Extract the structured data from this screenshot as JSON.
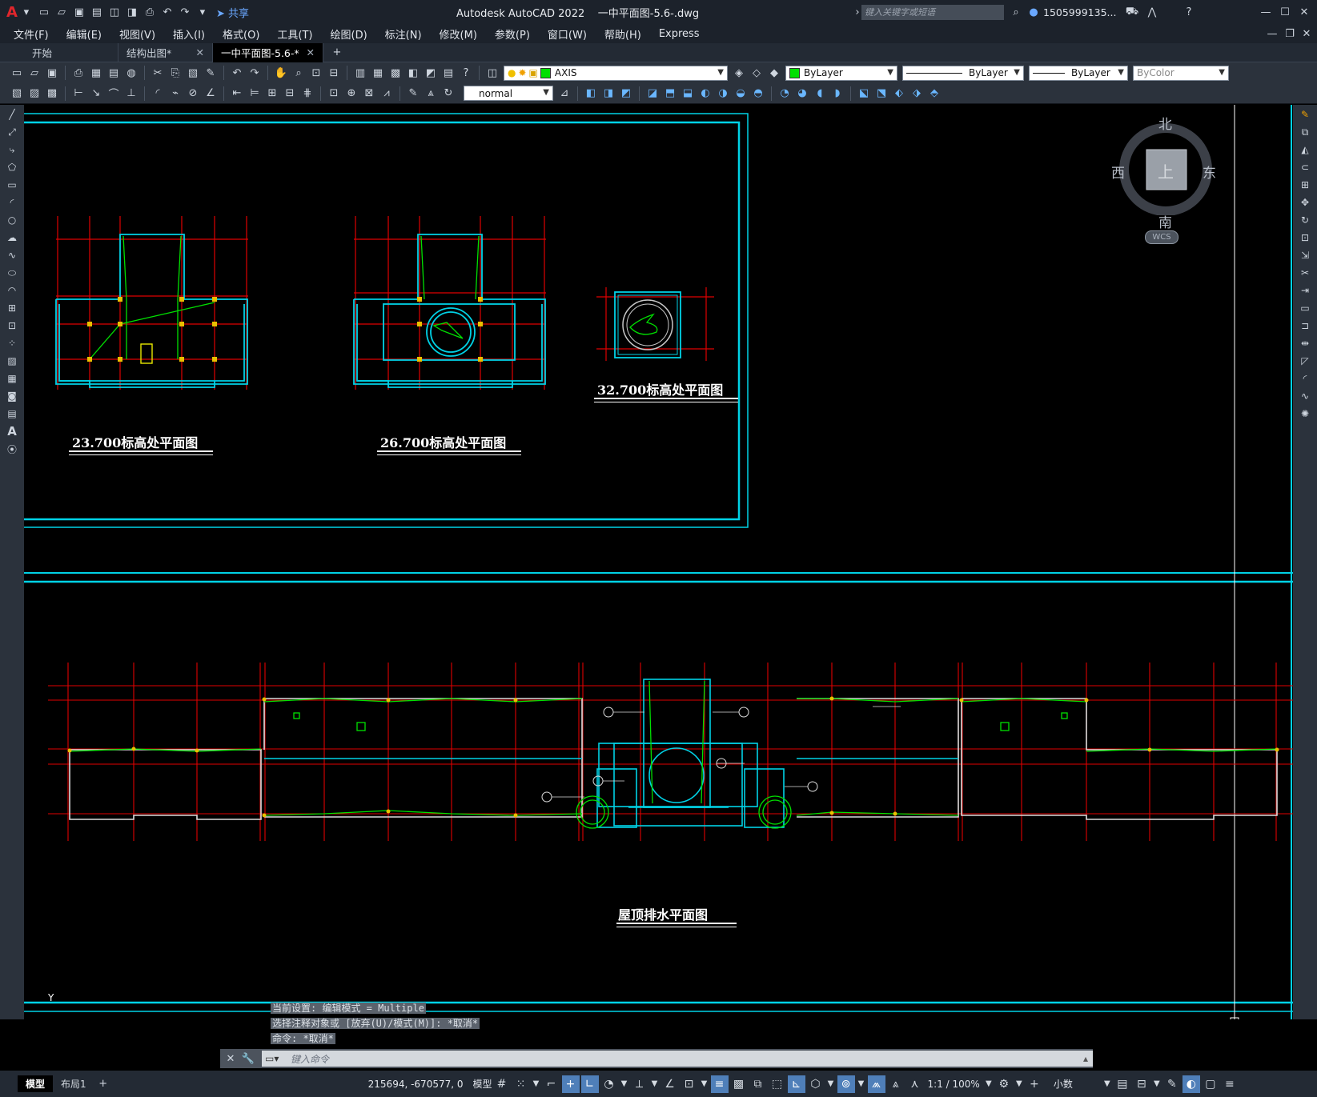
{
  "app": {
    "title": "Autodesk AutoCAD 2022    一中平面图-5.6-.dwg",
    "search_placeholder": "键入关键字或短语",
    "user": "1505999135...",
    "share": "共享",
    "logo": "A"
  },
  "menu": [
    "文件(F)",
    "编辑(E)",
    "视图(V)",
    "插入(I)",
    "格式(O)",
    "工具(T)",
    "绘图(D)",
    "标注(N)",
    "修改(M)",
    "参数(P)",
    "窗口(W)",
    "帮助(H)",
    "Express"
  ],
  "tabs": [
    {
      "label": "开始",
      "active": false,
      "closable": false
    },
    {
      "label": "结构出图*",
      "active": false,
      "closable": true
    },
    {
      "label": "一中平面图-5.6-*",
      "active": true,
      "closable": true
    }
  ],
  "toolbar": {
    "layer": "AXIS",
    "color": "ByLayer",
    "linetype": "ByLayer",
    "lineweight": "ByLayer",
    "plotstyle": "ByColor",
    "annotation_style": "normal"
  },
  "drawing": {
    "titles": [
      "23.700标高处平面图",
      "26.700标高处平面图",
      "32.700标高处平面图",
      "屋顶排水平面图"
    ]
  },
  "viewcube": {
    "north": "北",
    "south": "南",
    "east": "东",
    "west": "西",
    "top": "上",
    "wcs": "WCS"
  },
  "ucs": {
    "y": "Y"
  },
  "command": {
    "history": [
      "当前设置: 编辑模式 = Multiple",
      "选择注释对象或 [放弃(U)/模式(M)]: *取消*",
      "命令: *取消*"
    ],
    "placeholder": "键入命令"
  },
  "status": {
    "layout_tabs": [
      "模型",
      "布局1"
    ],
    "coords": "215694, -670577, 0",
    "model": "模型",
    "scale": "1:1 / 100%",
    "units": "小数"
  }
}
